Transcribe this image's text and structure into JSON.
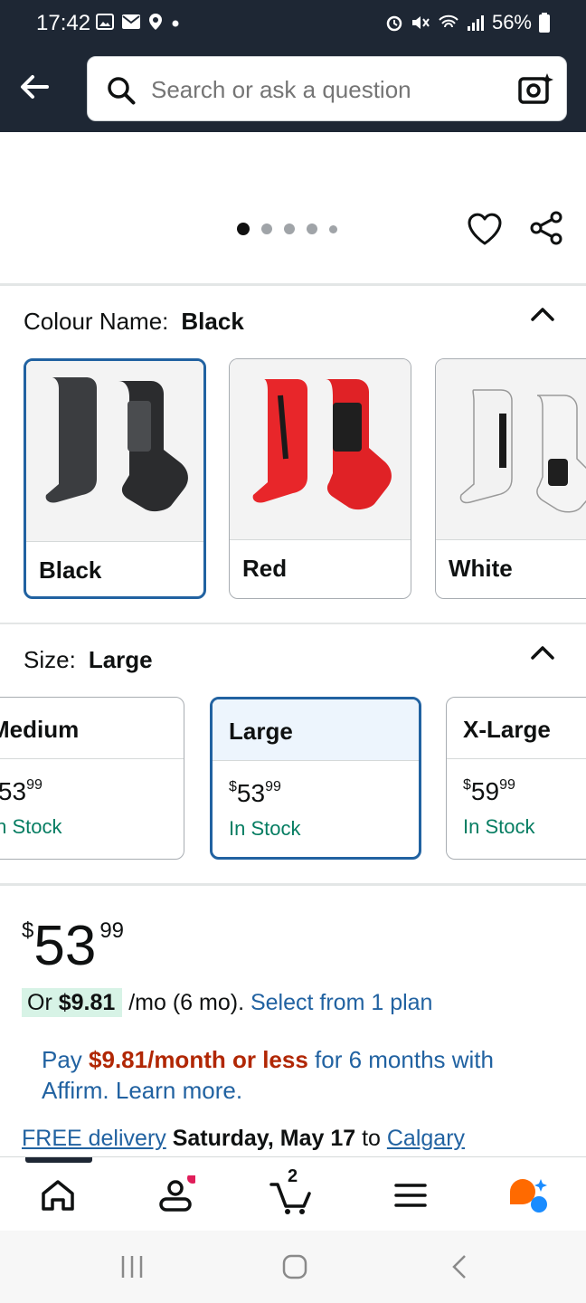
{
  "status_bar": {
    "time": "17:42",
    "battery": "56%",
    "icons": [
      "gallery-icon",
      "mail-icon",
      "location-icon",
      "dot-icon",
      "alarm-icon",
      "mute-icon",
      "wifi-icon",
      "signal-icon",
      "battery-icon"
    ]
  },
  "search": {
    "placeholder": "Search or ask a question"
  },
  "gallery": {
    "dots_count": 5,
    "active_index": 0
  },
  "colour": {
    "label": "Colour Name:",
    "value": "Black",
    "options": [
      {
        "name": "Black",
        "selected": true
      },
      {
        "name": "Red",
        "selected": false
      },
      {
        "name": "White",
        "selected": false
      }
    ]
  },
  "size": {
    "label": "Size:",
    "value": "Large",
    "options": [
      {
        "name": "Medium",
        "price_whole": "53",
        "price_cents": "99",
        "currency": "$",
        "stock": "In Stock",
        "selected": false
      },
      {
        "name": "Large",
        "price_whole": "53",
        "price_cents": "99",
        "currency": "$",
        "stock": "In Stock",
        "selected": true
      },
      {
        "name": "X-Large",
        "price_whole": "59",
        "price_cents": "99",
        "currency": "$",
        "stock": "In Stock",
        "selected": false
      }
    ]
  },
  "price": {
    "currency": "$",
    "whole": "53",
    "cents": "99",
    "monthly_prefix": "Or ",
    "monthly_amount": "$9.81",
    "monthly_suffix": " /mo (6 mo). ",
    "plan_link": "Select from 1 plan"
  },
  "affirm": {
    "pay": "Pay ",
    "amount": "$9.81/month or less",
    "rest": " for 6 months with Affirm. Learn more."
  },
  "delivery": {
    "free": "FREE delivery",
    "date": "Saturday, May 17",
    "to": " to ",
    "city": "Calgary"
  },
  "bottom_nav": {
    "cart_count": "2",
    "items": [
      "home-icon",
      "account-icon",
      "cart-icon",
      "menu-icon",
      "rufus-icon"
    ]
  },
  "colors": {
    "header_bg": "#1e2734",
    "link": "#2162a1",
    "stock_green": "#067d62",
    "price_red": "#b12704",
    "selected_border": "#2162a1"
  }
}
